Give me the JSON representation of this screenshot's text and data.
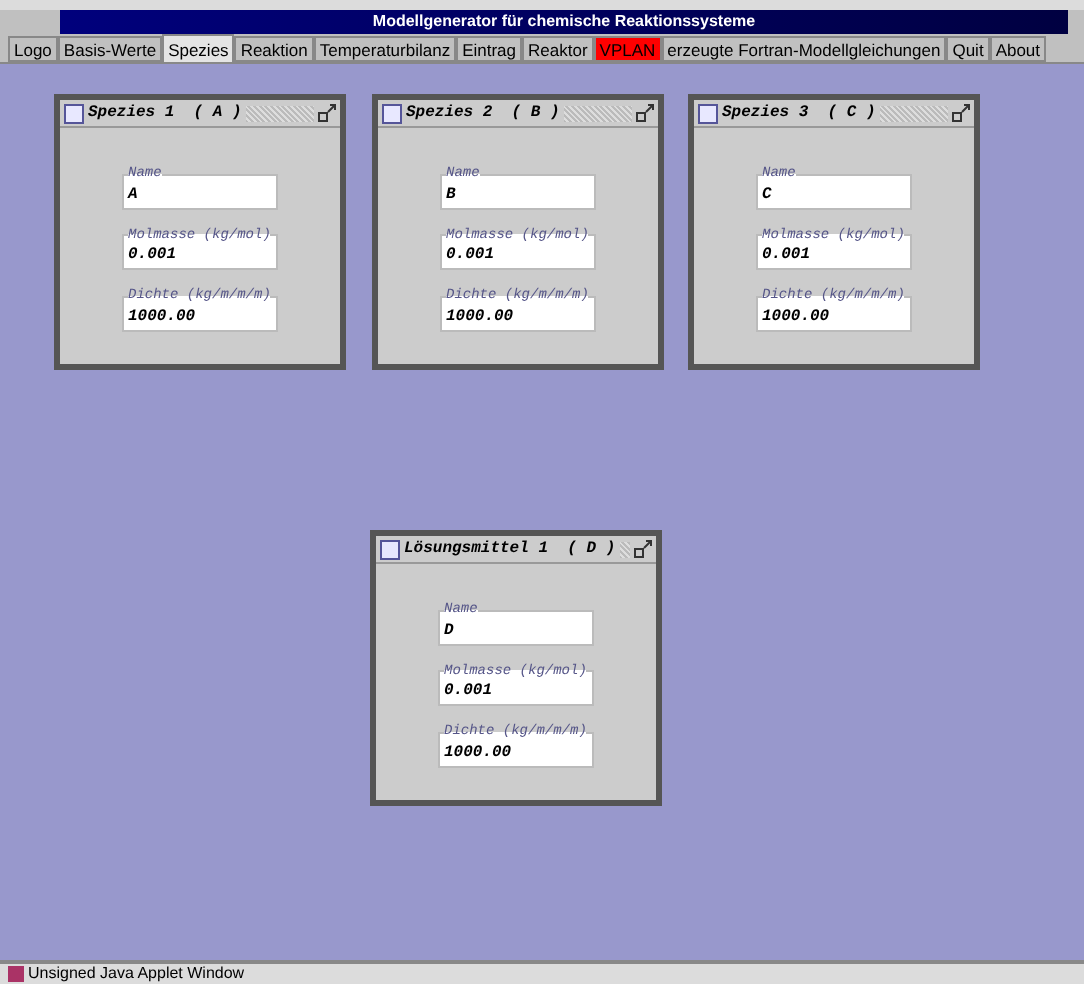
{
  "window": {
    "title": "Modellgenerator für chemische Reaktionssysteme"
  },
  "tabs": [
    {
      "label": "Logo",
      "selected": false,
      "color": "#c0c0c0"
    },
    {
      "label": "Basis-Werte",
      "selected": false,
      "color": "#c0c0c0"
    },
    {
      "label": "Spezies",
      "selected": true,
      "color": "#e4e4e4"
    },
    {
      "label": "Reaktion",
      "selected": false,
      "color": "#c0c0c0"
    },
    {
      "label": "Temperaturbilanz",
      "selected": false,
      "color": "#c0c0c0"
    },
    {
      "label": "Eintrag",
      "selected": false,
      "color": "#c0c0c0"
    },
    {
      "label": "Reaktor",
      "selected": false,
      "color": "#c0c0c0"
    },
    {
      "label": "VPLAN",
      "selected": false,
      "color": "#ff0000"
    },
    {
      "label": "erzeugte Fortran-Modellgleichungen",
      "selected": false,
      "color": "#c0c0c0"
    },
    {
      "label": "Quit",
      "selected": false,
      "color": "#c0c0c0"
    },
    {
      "label": "About",
      "selected": false,
      "color": "#c0c0c0"
    }
  ],
  "frames": [
    {
      "title": "Spezies 1  ( A )",
      "fields": [
        {
          "label": "Name",
          "value": "A"
        },
        {
          "label": "Molmasse (kg/mol)",
          "value": "0.001"
        },
        {
          "label": "Dichte (kg/m/m/m)",
          "value": "1000.00"
        }
      ]
    },
    {
      "title": "Spezies 2  ( B )",
      "fields": [
        {
          "label": "Name",
          "value": "B"
        },
        {
          "label": "Molmasse (kg/mol)",
          "value": "0.001"
        },
        {
          "label": "Dichte (kg/m/m/m)",
          "value": "1000.00"
        }
      ]
    },
    {
      "title": "Spezies 3  ( C )",
      "fields": [
        {
          "label": "Name",
          "value": "C"
        },
        {
          "label": "Molmasse (kg/mol)",
          "value": "0.001"
        },
        {
          "label": "Dichte (kg/m/m/m)",
          "value": "1000.00"
        }
      ]
    },
    {
      "title": "Lösungsmittel 1  ( D )",
      "fields": [
        {
          "label": "Name",
          "value": "D"
        },
        {
          "label": "Molmasse (kg/mol)",
          "value": "0.001"
        },
        {
          "label": "Dichte (kg/m/m/m)",
          "value": "1000.00"
        }
      ]
    }
  ],
  "status_bar": {
    "text": "Unsigned Java Applet Window"
  }
}
